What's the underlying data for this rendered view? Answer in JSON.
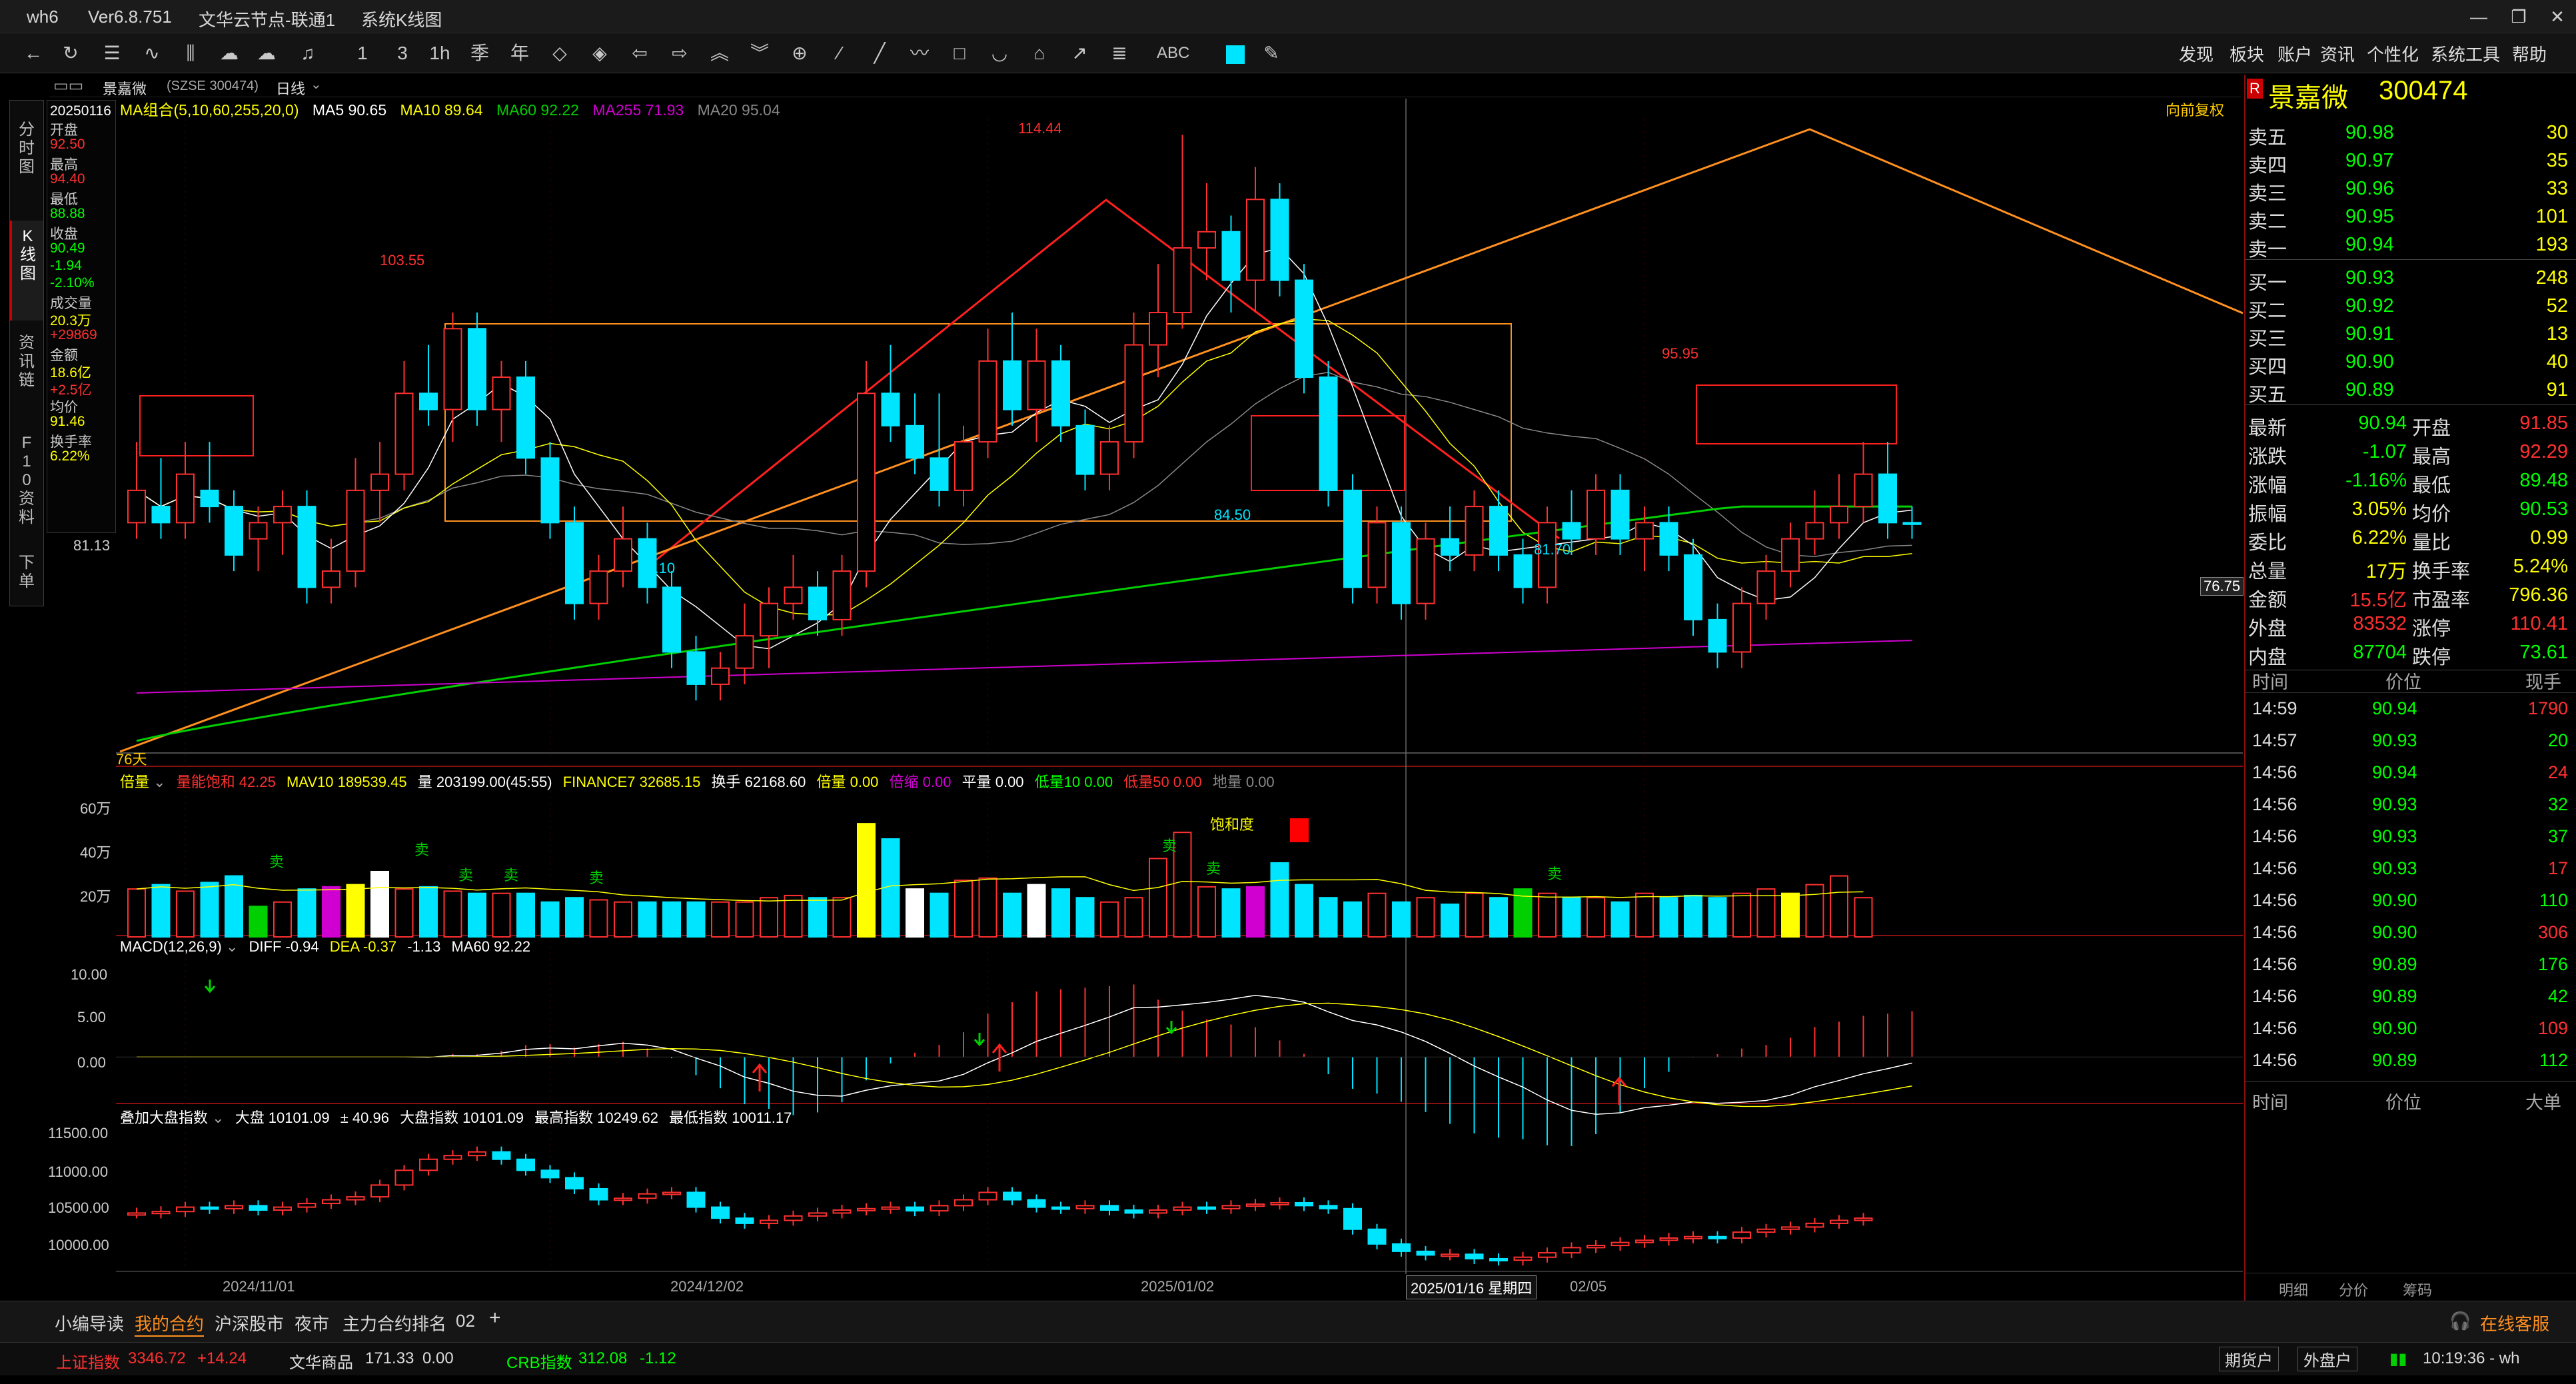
{
  "window": {
    "app": "wh6",
    "version": "Ver6.8.751",
    "server": "文华云节点-联通1",
    "title": "系统K线图"
  },
  "menu": [
    "发现",
    "板块",
    "账户",
    "资讯",
    "个性化",
    "系统工具",
    "帮助"
  ],
  "toolbar_labels": {
    "abc": "ABC"
  },
  "side_tabs": [
    "分时图",
    "K线图",
    "资讯链",
    "F10资料",
    "下单"
  ],
  "chart_header": {
    "name": "景嘉微",
    "code": "(SZSE 300474)",
    "period": "日线"
  },
  "colors": {
    "up": "#ff3030",
    "down": "#00e5ff",
    "ma5": "#ffffff",
    "ma10": "#ffff00",
    "ma60": "#00d000",
    "ma255": "#d000d0",
    "ma20": "#888888",
    "accent": "#ff9020"
  },
  "ma_legend": {
    "title": "MA组合(5,10,60,255,20,0)",
    "ma5": "MA5 90.65",
    "ma10": "MA10 89.64",
    "ma60": "MA60 92.22",
    "ma255": "MA255 71.93",
    "ma20": "MA20 95.04"
  },
  "fq": "向前复权",
  "info_col": [
    {
      "k": "date",
      "v": "20250116",
      "c": "#ffffff"
    },
    {
      "k": "开盘",
      "v": "",
      "c": "#cccccc"
    },
    {
      "k": "open",
      "v": "92.50",
      "c": "#ff3030"
    },
    {
      "k": "最高",
      "v": "",
      "c": "#cccccc"
    },
    {
      "k": "high",
      "v": "94.40",
      "c": "#ff3030"
    },
    {
      "k": "最低",
      "v": "",
      "c": "#cccccc"
    },
    {
      "k": "low",
      "v": "88.88",
      "c": "#00ff00"
    },
    {
      "k": "收盘",
      "v": "",
      "c": "#cccccc"
    },
    {
      "k": "close",
      "v": "90.49",
      "c": "#00ff00"
    },
    {
      "k": "chg",
      "v": "-1.94",
      "c": "#00ff00"
    },
    {
      "k": "pct",
      "v": "-2.10%",
      "c": "#00ff00"
    },
    {
      "k": "成交量",
      "v": "",
      "c": "#cccccc"
    },
    {
      "k": "vol",
      "v": "20.3万",
      "c": "#ffff00"
    },
    {
      "k": "dvol",
      "v": "+29869",
      "c": "#ff3030"
    },
    {
      "k": "金额",
      "v": "",
      "c": "#cccccc"
    },
    {
      "k": "amt",
      "v": "18.6亿",
      "c": "#ffff00"
    },
    {
      "k": "damt",
      "v": "+2.5亿",
      "c": "#ff3030"
    },
    {
      "k": "均价",
      "v": "",
      "c": "#cccccc"
    },
    {
      "k": "avg",
      "v": "91.46",
      "c": "#ffff00"
    },
    {
      "k": "换手率",
      "v": "",
      "c": "#cccccc"
    },
    {
      "k": "turn",
      "v": "6.22%",
      "c": "#ffff00"
    }
  ],
  "price_axis": {
    "mark": "81.13",
    "cur": "76.75",
    "bars": "76天"
  },
  "annotations": {
    "h1": "114.44",
    "h2": "103.55",
    "h3": "95.95",
    "l1": "80.10",
    "l2": "84.50",
    "l3": "81.70"
  },
  "vol_header": {
    "a": "倍量",
    "b": "量能饱和 42.25",
    "c": "MAV10 189539.45",
    "d": "量 203199.00(45:55)",
    "e": "FINANCE7 32685.15",
    "f": "换手 62168.60",
    "g": "倍量 0.00",
    "h": "倍缩 0.00",
    "i": "平量 0.00",
    "j": "低量10 0.00",
    "k": "低量50 0.00",
    "l": "地量 0.00"
  },
  "vol_axis": [
    "60万",
    "40万",
    "20万"
  ],
  "vol_note": "饱和度",
  "sell_mark": "卖",
  "macd_header": {
    "a": "MACD(12,26,9)",
    "b": "DIFF -0.94",
    "c": "DEA -0.37",
    "d": "-1.13",
    "e": "MA60 92.22"
  },
  "macd_axis": [
    "10.00",
    "5.00",
    "0.00"
  ],
  "idx_header": {
    "a": "叠加大盘指数",
    "b": "大盘 10101.09",
    "c": "± 40.96",
    "d": "大盘指数 10101.09",
    "e": "最高指数 10249.62",
    "f": "最低指数 10011.17"
  },
  "idx_axis": [
    "11500.00",
    "11000.00",
    "10500.00",
    "10000.00"
  ],
  "dates": [
    "2024/11/01",
    "2024/12/02",
    "2025/01/02",
    "02/05"
  ],
  "cursor_date": "2025/01/16 星期四",
  "quote": {
    "badge": "R",
    "name": "景嘉微",
    "code": "300474",
    "asks": [
      {
        "l": "卖五",
        "p": "90.98",
        "v": "30"
      },
      {
        "l": "卖四",
        "p": "90.97",
        "v": "35"
      },
      {
        "l": "卖三",
        "p": "90.96",
        "v": "33"
      },
      {
        "l": "卖二",
        "p": "90.95",
        "v": "101"
      },
      {
        "l": "卖一",
        "p": "90.94",
        "v": "193"
      }
    ],
    "bids": [
      {
        "l": "买一",
        "p": "90.93",
        "v": "248"
      },
      {
        "l": "买二",
        "p": "90.92",
        "v": "52"
      },
      {
        "l": "买三",
        "p": "90.91",
        "v": "13"
      },
      {
        "l": "买四",
        "p": "90.90",
        "v": "40"
      },
      {
        "l": "买五",
        "p": "90.89",
        "v": "91"
      }
    ],
    "stats": [
      {
        "a": "最新",
        "av": "90.94",
        "ac": "#00ff00",
        "b": "开盘",
        "bv": "91.85",
        "bc": "#ff3030"
      },
      {
        "a": "涨跌",
        "av": "-1.07",
        "ac": "#00ff00",
        "b": "最高",
        "bv": "92.29",
        "bc": "#ff3030"
      },
      {
        "a": "涨幅",
        "av": "-1.16%",
        "ac": "#00ff00",
        "b": "最低",
        "bv": "89.48",
        "bc": "#00ff00"
      },
      {
        "a": "振幅",
        "av": "3.05%",
        "ac": "#ffff00",
        "b": "均价",
        "bv": "90.53",
        "bc": "#00ff00"
      },
      {
        "a": "委比",
        "av": "6.22%",
        "ac": "#ffff00",
        "b": "量比",
        "bv": "0.99",
        "bc": "#ffff00"
      },
      {
        "a": "总量",
        "av": "17万",
        "ac": "#ffff00",
        "b": "换手率",
        "bv": "5.24%",
        "bc": "#ffff00"
      },
      {
        "a": "金额",
        "av": "15.5亿",
        "ac": "#ff3030",
        "b": "市盈率",
        "bv": "796.36",
        "bc": "#ffff00"
      },
      {
        "a": "外盘",
        "av": "83532",
        "ac": "#ff3030",
        "b": "涨停",
        "bv": "110.41",
        "bc": "#ff3030"
      },
      {
        "a": "内盘",
        "av": "87704",
        "ac": "#00ff00",
        "b": "跌停",
        "bv": "73.61",
        "bc": "#00ff00"
      }
    ],
    "tick_header": {
      "t": "时间",
      "p": "价位",
      "v": "现手"
    },
    "ticks": [
      {
        "t": "14:59",
        "p": "90.94",
        "v": "1790",
        "c": "#ff3030"
      },
      {
        "t": "14:57",
        "p": "90.93",
        "v": "20",
        "c": "#00ff00"
      },
      {
        "t": "14:56",
        "p": "90.94",
        "v": "24",
        "c": "#ff3030"
      },
      {
        "t": "14:56",
        "p": "90.93",
        "v": "32",
        "c": "#00ff00"
      },
      {
        "t": "14:56",
        "p": "90.93",
        "v": "37",
        "c": "#00ff00"
      },
      {
        "t": "14:56",
        "p": "90.93",
        "v": "17",
        "c": "#ff3030"
      },
      {
        "t": "14:56",
        "p": "90.90",
        "v": "110",
        "c": "#00ff00"
      },
      {
        "t": "14:56",
        "p": "90.90",
        "v": "306",
        "c": "#ff3030"
      },
      {
        "t": "14:56",
        "p": "90.89",
        "v": "176",
        "c": "#00ff00"
      },
      {
        "t": "14:56",
        "p": "90.89",
        "v": "42",
        "c": "#00ff00"
      },
      {
        "t": "14:56",
        "p": "90.90",
        "v": "109",
        "c": "#ff3030"
      },
      {
        "t": "14:56",
        "p": "90.89",
        "v": "112",
        "c": "#00ff00"
      }
    ],
    "big_header": {
      "t": "时间",
      "p": "价位",
      "v": "大单"
    },
    "bottom_tabs": [
      "明细",
      "分价",
      "筹码"
    ]
  },
  "bottom_tabs": [
    "小编导读",
    "我的合约",
    "沪深股市",
    "夜市",
    "主力合约排名",
    "02",
    "+"
  ],
  "service": "在线客服",
  "status": {
    "i1": "上证指数",
    "v1": "3346.72",
    "c1": "+14.24",
    "i2": "文华商品",
    "v2": "171.33",
    "c2": "0.00",
    "i3": "CRB指数",
    "v3": "312.08",
    "c3": "-1.12",
    "b1": "期货户",
    "b2": "外盘户",
    "time": "10:19:36 - wh"
  },
  "chart_data": {
    "type": "candlestick",
    "price_ylim": [
      76.75,
      116
    ],
    "candles": [
      {
        "o": 91,
        "h": 96,
        "l": 90,
        "c": 93
      },
      {
        "o": 92,
        "h": 95,
        "l": 90,
        "c": 91
      },
      {
        "o": 91,
        "h": 96,
        "l": 90,
        "c": 94
      },
      {
        "o": 93,
        "h": 96,
        "l": 91,
        "c": 92
      },
      {
        "o": 92,
        "h": 93,
        "l": 88,
        "c": 89
      },
      {
        "o": 90,
        "h": 92,
        "l": 88,
        "c": 91
      },
      {
        "o": 91,
        "h": 93,
        "l": 89,
        "c": 92
      },
      {
        "o": 92,
        "h": 93,
        "l": 86,
        "c": 87
      },
      {
        "o": 87,
        "h": 90,
        "l": 86,
        "c": 88
      },
      {
        "o": 88,
        "h": 95,
        "l": 87,
        "c": 93
      },
      {
        "o": 93,
        "h": 96,
        "l": 91,
        "c": 94
      },
      {
        "o": 94,
        "h": 101,
        "l": 93,
        "c": 99
      },
      {
        "o": 99,
        "h": 102,
        "l": 97,
        "c": 98
      },
      {
        "o": 98,
        "h": 104,
        "l": 96,
        "c": 103
      },
      {
        "o": 103,
        "h": 104,
        "l": 97,
        "c": 98
      },
      {
        "o": 98,
        "h": 101,
        "l": 96,
        "c": 100
      },
      {
        "o": 100,
        "h": 101,
        "l": 94,
        "c": 95
      },
      {
        "o": 95,
        "h": 96,
        "l": 90,
        "c": 91
      },
      {
        "o": 91,
        "h": 92,
        "l": 85,
        "c": 86
      },
      {
        "o": 86,
        "h": 89,
        "l": 85,
        "c": 88
      },
      {
        "o": 88,
        "h": 92,
        "l": 87,
        "c": 90
      },
      {
        "o": 90,
        "h": 91,
        "l": 86,
        "c": 87
      },
      {
        "o": 87,
        "h": 88,
        "l": 82,
        "c": 83
      },
      {
        "o": 83,
        "h": 84,
        "l": 80,
        "c": 81
      },
      {
        "o": 81,
        "h": 83,
        "l": 80,
        "c": 82
      },
      {
        "o": 82,
        "h": 86,
        "l": 81,
        "c": 84
      },
      {
        "o": 84,
        "h": 87,
        "l": 82,
        "c": 86
      },
      {
        "o": 86,
        "h": 89,
        "l": 85,
        "c": 87
      },
      {
        "o": 87,
        "h": 88,
        "l": 84,
        "c": 85
      },
      {
        "o": 85,
        "h": 89,
        "l": 84,
        "c": 88
      },
      {
        "o": 88,
        "h": 101,
        "l": 87,
        "c": 99
      },
      {
        "o": 99,
        "h": 102,
        "l": 96,
        "c": 97
      },
      {
        "o": 97,
        "h": 99,
        "l": 94,
        "c": 95
      },
      {
        "o": 95,
        "h": 99,
        "l": 92,
        "c": 93
      },
      {
        "o": 93,
        "h": 97,
        "l": 92,
        "c": 96
      },
      {
        "o": 96,
        "h": 103,
        "l": 95,
        "c": 101
      },
      {
        "o": 101,
        "h": 104,
        "l": 97,
        "c": 98
      },
      {
        "o": 98,
        "h": 103,
        "l": 96,
        "c": 101
      },
      {
        "o": 101,
        "h": 102,
        "l": 96,
        "c": 97
      },
      {
        "o": 97,
        "h": 98,
        "l": 93,
        "c": 94
      },
      {
        "o": 94,
        "h": 97,
        "l": 93,
        "c": 96
      },
      {
        "o": 96,
        "h": 104,
        "l": 95,
        "c": 102
      },
      {
        "o": 102,
        "h": 107,
        "l": 100,
        "c": 104
      },
      {
        "o": 104,
        "h": 115,
        "l": 103,
        "c": 108
      },
      {
        "o": 108,
        "h": 112,
        "l": 106,
        "c": 109
      },
      {
        "o": 109,
        "h": 110,
        "l": 104,
        "c": 106
      },
      {
        "o": 106,
        "h": 113,
        "l": 104,
        "c": 111
      },
      {
        "o": 111,
        "h": 112,
        "l": 105,
        "c": 106
      },
      {
        "o": 106,
        "h": 107,
        "l": 99,
        "c": 100
      },
      {
        "o": 100,
        "h": 101,
        "l": 92,
        "c": 93
      },
      {
        "o": 93,
        "h": 94,
        "l": 86,
        "c": 87
      },
      {
        "o": 87,
        "h": 92,
        "l": 86,
        "c": 91
      },
      {
        "o": 91,
        "h": 92,
        "l": 85,
        "c": 86
      },
      {
        "o": 86,
        "h": 91,
        "l": 85,
        "c": 90
      },
      {
        "o": 90,
        "h": 92,
        "l": 88,
        "c": 89
      },
      {
        "o": 89,
        "h": 93,
        "l": 88,
        "c": 92
      },
      {
        "o": 92,
        "h": 93,
        "l": 88,
        "c": 89
      },
      {
        "o": 89,
        "h": 90,
        "l": 86,
        "c": 87
      },
      {
        "o": 87,
        "h": 92,
        "l": 86,
        "c": 91
      },
      {
        "o": 91,
        "h": 93,
        "l": 89,
        "c": 90
      },
      {
        "o": 90,
        "h": 94,
        "l": 89,
        "c": 93
      },
      {
        "o": 93,
        "h": 94,
        "l": 89,
        "c": 90
      },
      {
        "o": 90,
        "h": 92,
        "l": 88,
        "c": 91
      },
      {
        "o": 91,
        "h": 92,
        "l": 88,
        "c": 89
      },
      {
        "o": 89,
        "h": 90,
        "l": 84,
        "c": 85
      },
      {
        "o": 85,
        "h": 86,
        "l": 82,
        "c": 83
      },
      {
        "o": 83,
        "h": 87,
        "l": 82,
        "c": 86
      },
      {
        "o": 86,
        "h": 89,
        "l": 85,
        "c": 88
      },
      {
        "o": 88,
        "h": 91,
        "l": 87,
        "c": 90
      },
      {
        "o": 90,
        "h": 93,
        "l": 89,
        "c": 91
      },
      {
        "o": 91,
        "h": 94,
        "l": 90,
        "c": 92
      },
      {
        "o": 92,
        "h": 96,
        "l": 91,
        "c": 94
      },
      {
        "o": 94,
        "h": 96,
        "l": 90,
        "c": 91
      },
      {
        "o": 91,
        "h": 92,
        "l": 90,
        "c": 90.9
      }
    ],
    "volume": [
      22,
      24,
      21,
      25,
      28,
      14,
      16,
      22,
      23,
      24,
      30,
      22,
      23,
      21,
      20,
      20,
      20,
      16,
      18,
      17,
      16,
      16,
      16,
      16,
      16,
      16,
      18,
      19,
      18,
      18,
      52,
      45,
      22,
      20,
      26,
      27,
      20,
      24,
      22,
      18,
      16,
      18,
      36,
      48,
      23,
      22,
      23,
      34,
      24,
      18,
      16,
      20,
      16,
      18,
      15,
      20,
      18,
      22,
      20,
      18,
      18,
      16,
      20,
      18,
      19,
      18,
      20,
      22,
      20,
      24,
      28,
      18
    ],
    "macd_ylim": [
      -5,
      11
    ],
    "index_ylim": [
      9800,
      11700
    ],
    "index_closes": [
      10520,
      10540,
      10600,
      10580,
      10620,
      10560,
      10600,
      10650,
      10700,
      10740,
      10900,
      11100,
      11250,
      11300,
      11350,
      11250,
      11100,
      11000,
      10850,
      10700,
      10720,
      10780,
      10800,
      10600,
      10450,
      10380,
      10420,
      10480,
      10520,
      10560,
      10580,
      10600,
      10550,
      10620,
      10700,
      10800,
      10700,
      10600,
      10580,
      10620,
      10560,
      10520,
      10560,
      10600,
      10580,
      10620,
      10640,
      10660,
      10620,
      10580,
      10300,
      10100,
      10000,
      9950,
      9960,
      9900,
      9880,
      9920,
      9980,
      10050,
      10080,
      10120,
      10150,
      10180,
      10200,
      10180,
      10260,
      10300,
      10330,
      10380,
      10420,
      10450
    ]
  }
}
